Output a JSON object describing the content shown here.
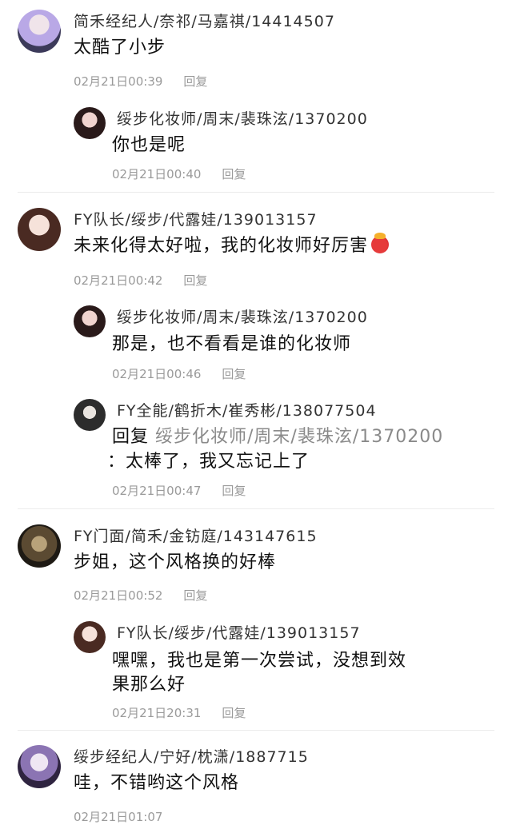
{
  "comments": [
    {
      "name": "简禾经纪人/奈祁/马嘉祺/14414507",
      "text": "太酷了小步",
      "date": "02月21日00:39",
      "reply_label": "回复",
      "avatar_colors": [
        "#b9a8e6",
        "#3c3a5a"
      ],
      "replies": [
        {
          "name": "绥步化妆师/周末/裴珠泫/1370200",
          "text": "你也是呢",
          "date": "02月21日00:40",
          "reply_label": "回复",
          "avatar_colors": [
            "#e8c9c2",
            "#2a1a1a"
          ]
        }
      ]
    },
    {
      "name": "FY队长/绥步/代露娃/139013157",
      "text": "未来化得太好啦，我的化妆师好厉害",
      "date": "02月21日00:42",
      "reply_label": "回复",
      "avatar_colors": [
        "#f3d9d0",
        "#4a2a22"
      ],
      "replies": [
        {
          "name": "绥步化妆师/周末/裴珠泫/1370200",
          "text": "那是，也不看看是谁的化妆师",
          "date": "02月21日00:46",
          "reply_label": "回复",
          "avatar_colors": [
            "#e8c9c2",
            "#2a1a1a"
          ]
        },
        {
          "name": "FY全能/鹤折木/崔秀彬/138077504",
          "reply_prefix": "回复",
          "reply_target": "绥步化妆师/周末/裴珠泫/1370200",
          "text_line1": "",
          "text_line2": "：太棒了，我又忘记上了",
          "date": "02月21日00:47",
          "reply_label": "回复",
          "avatar_colors": [
            "#d6d6d6",
            "#2c2c2c"
          ]
        }
      ]
    },
    {
      "name": "FY门面/简禾/金钫庭/143147615",
      "text": "步姐，这个风格换的好棒",
      "date": "02月21日00:52",
      "reply_label": "回复",
      "avatar_colors": [
        "#7a6a4a",
        "#1e1a14"
      ],
      "replies": [
        {
          "name": "FY队长/绥步/代露娃/139013157",
          "text_line1": "嘿嘿，我也是第一次尝试，没想到效",
          "text_line2": "果那么好",
          "date": "02月21日20:31",
          "reply_label": "回复",
          "avatar_colors": [
            "#f3d9d0",
            "#4a2a22"
          ]
        }
      ]
    },
    {
      "name": "绥步经纪人/宁好/枕潇/1887715",
      "text": "哇，不错哟这个风格",
      "date": "02月21日01:07",
      "avatar_colors": [
        "#c9b7de",
        "#2f2440"
      ]
    }
  ]
}
